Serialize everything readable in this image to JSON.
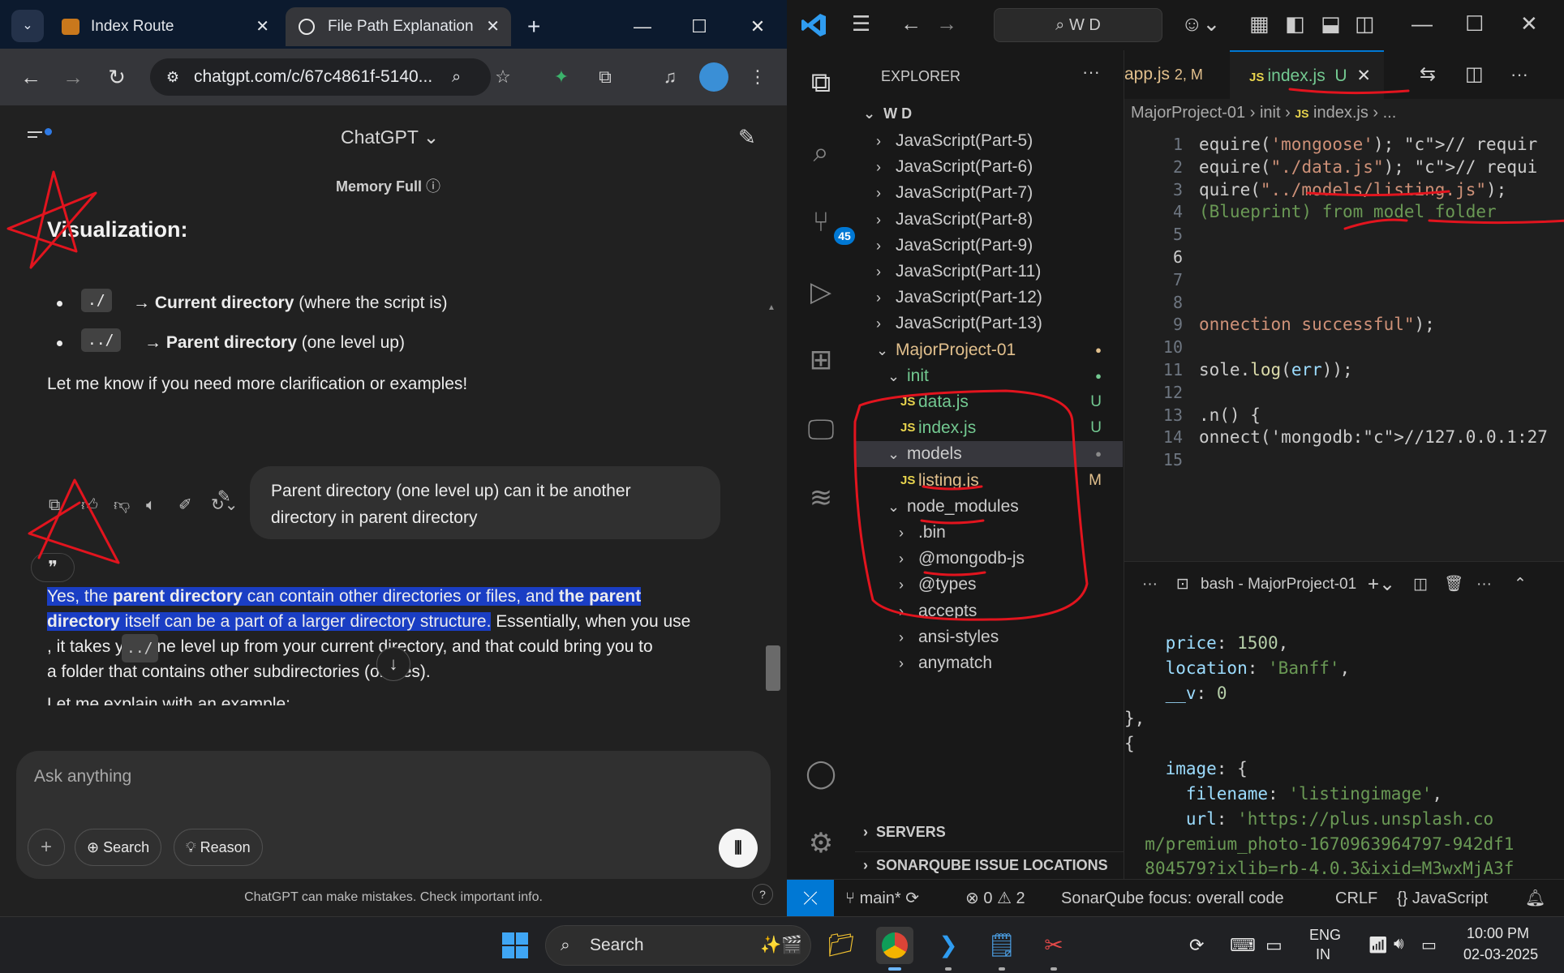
{
  "chrome": {
    "tabs": [
      {
        "title": "Index Route",
        "active": false
      },
      {
        "title": "File Path Explanation",
        "active": true
      }
    ],
    "url": "chatgpt.com/c/67c4861f-5140..."
  },
  "chatgpt": {
    "model": "ChatGPT",
    "memory": "Memory Full",
    "heading": "Visualization:",
    "bullets": [
      {
        "code": "./",
        "bold": "Current directory",
        "rest": " (where the script is)"
      },
      {
        "code": "../",
        "bold": "Parent directory",
        "rest": " (one level up)"
      }
    ],
    "followup": "Let me know if you need more clarification or examples!",
    "user_message": "Parent directory (one level up) can it be another directory in parent directory",
    "answer": {
      "l1_a": "Yes, the ",
      "l1_b": "parent directory",
      "l1_c": " can contain other directories or files, and ",
      "l1_d": "the parent",
      "l2_a": "directory",
      "l2_b": " itself can be a part of a larger directory structure.",
      "l2_c": " Essentially, when you use",
      "l3_code": "../",
      "l3_rest": ", it takes you one level up from your current directory, and that could bring you to",
      "l4": "a folder that contains other subdirectories (or files).",
      "l5": "Let me explain with an example:"
    },
    "composer": {
      "placeholder": "Ask anything",
      "search": "Search",
      "reason": "Reason"
    },
    "disclaimer": "ChatGPT can make mistakes. Check important info.",
    "help": "?"
  },
  "vscode": {
    "command_center": "W D",
    "explorer_title": "EXPLORER",
    "root": "W D",
    "scm_badge": "45",
    "tree": [
      {
        "name": "JavaScript(Part-5)",
        "kind": "folder",
        "open": false
      },
      {
        "name": "JavaScript(Part-6)",
        "kind": "folder",
        "open": false
      },
      {
        "name": "JavaScript(Part-7)",
        "kind": "folder",
        "open": false
      },
      {
        "name": "JavaScript(Part-8)",
        "kind": "folder",
        "open": false
      },
      {
        "name": "JavaScript(Part-9)",
        "kind": "folder",
        "open": false
      },
      {
        "name": "JavaScript(Part-11)",
        "kind": "folder",
        "open": false
      },
      {
        "name": "JavaScript(Part-12)",
        "kind": "folder",
        "open": false
      },
      {
        "name": "JavaScript(Part-13)",
        "kind": "folder",
        "open": false
      },
      {
        "name": "MajorProject-01",
        "kind": "folder",
        "open": true
      },
      {
        "name": "init",
        "kind": "folder",
        "open": true
      },
      {
        "name": "data.js",
        "kind": "file",
        "status": "U"
      },
      {
        "name": "index.js",
        "kind": "file",
        "status": "U"
      },
      {
        "name": "models",
        "kind": "folder",
        "open": true
      },
      {
        "name": "listing.js",
        "kind": "file",
        "status": "M"
      },
      {
        "name": "node_modules",
        "kind": "folder",
        "open": true
      },
      {
        "name": ".bin",
        "kind": "folder",
        "open": false
      },
      {
        "name": "@mongodb-js",
        "kind": "folder",
        "open": false
      },
      {
        "name": "@types",
        "kind": "folder",
        "open": false
      },
      {
        "name": "accepts",
        "kind": "folder",
        "open": false
      },
      {
        "name": "ansi-styles",
        "kind": "folder",
        "open": false
      },
      {
        "name": "anymatch",
        "kind": "folder",
        "open": false
      }
    ],
    "sections": [
      "SERVERS",
      "SONARQUBE ISSUE LOCATIONS"
    ],
    "editor_tabs": [
      {
        "name": "app.js",
        "status": "2, M"
      },
      {
        "name": "index.js",
        "status": "U"
      }
    ],
    "breadcrumb": [
      "MajorProject-01",
      "init",
      "index.js",
      "..."
    ],
    "line_numbers": [
      "1",
      "2",
      "3",
      "4",
      "5",
      "6",
      "7",
      "8",
      "9",
      "10",
      "11",
      "12",
      "13",
      "14",
      "15"
    ],
    "code_lines": [
      "equire('mongoose'); // requir",
      "equire(\"./data.js\"); // requi",
      "quire(\"../models/listing.js\");",
      "(Blueprint) from model folder",
      "",
      "",
      "",
      "",
      "onnection successful\");",
      "",
      "sole.log(err));",
      "",
      ".n() {",
      "onnect('mongodb://127.0.0.1:27",
      ""
    ],
    "terminal_title": "bash - MajorProject-01",
    "terminal": {
      "price_key": "price",
      "price_val": "1500",
      "location_key": "location",
      "location_val": "'Banff'",
      "v_key": "__v",
      "v_val": "0",
      "close_obj": "},",
      "open_obj": "{",
      "image_key": "image",
      "filename_key": "filename",
      "filename_val": "'listingimage'",
      "url_key": "url",
      "url_val": "'https://plus.unsplash.co",
      "url_cont1": "m/premium_photo-1670963964797-942df1",
      "url_cont2": "804579?ixlib=rb-4.0.3&ixid=M3wxMjA3f"
    },
    "status": {
      "branch": "main*",
      "errors": "0",
      "warnings": "2",
      "sonar": "SonarQube focus: overall code",
      "eol": "CRLF",
      "lang": "JavaScript"
    }
  },
  "taskbar": {
    "search": "Search",
    "lang": "ENG",
    "region": "IN",
    "time": "10:00 PM",
    "date": "02-03-2025"
  }
}
